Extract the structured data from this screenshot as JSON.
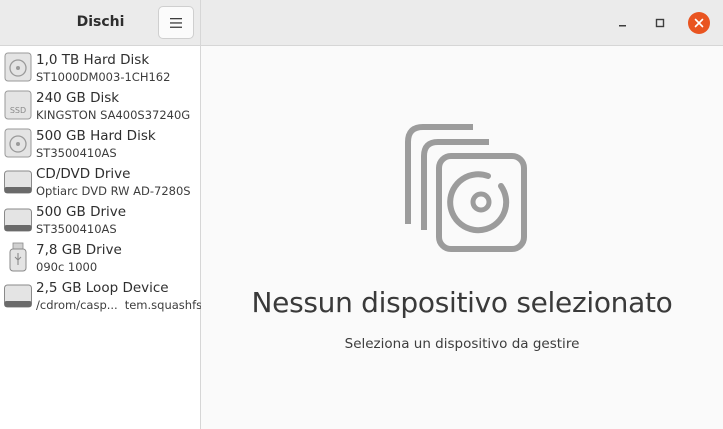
{
  "app": {
    "title": "Dischi"
  },
  "window_controls": {
    "menu_icon": "hamburger-icon",
    "minimize_icon": "minimize-icon",
    "maximize_icon": "maximize-icon",
    "close_icon": "close-icon",
    "close_color": "#e95420"
  },
  "sidebar": {
    "drives": [
      {
        "name": "1,0 TB Hard Disk",
        "model": "ST1000DM003-1CH162",
        "icon": "hard-disk-icon"
      },
      {
        "name": "240 GB Disk",
        "model": "KINGSTON SA400S37240G",
        "icon": "ssd-icon",
        "icon_label": "SSD"
      },
      {
        "name": "500 GB Hard Disk",
        "model": "ST3500410AS",
        "icon": "hard-disk-icon"
      },
      {
        "name": "CD/DVD Drive",
        "model": "Optiarc DVD RW AD-7280S",
        "icon": "optical-drive-icon"
      },
      {
        "name": "500 GB Drive",
        "model": "ST3500410AS",
        "icon": "drive-icon"
      },
      {
        "name": "7,8 GB Drive",
        "model": "090c 1000",
        "icon": "usb-drive-icon"
      },
      {
        "name": "2,5 GB Loop Device",
        "model_start": "/cdrom/casp...",
        "model_end": "tem.squashfs",
        "icon": "loop-device-icon"
      }
    ]
  },
  "main": {
    "empty_icon": "disks-app-icon",
    "empty_title": "Nessun dispositivo selezionato",
    "empty_subtitle": "Seleziona un dispositivo da gestire"
  }
}
